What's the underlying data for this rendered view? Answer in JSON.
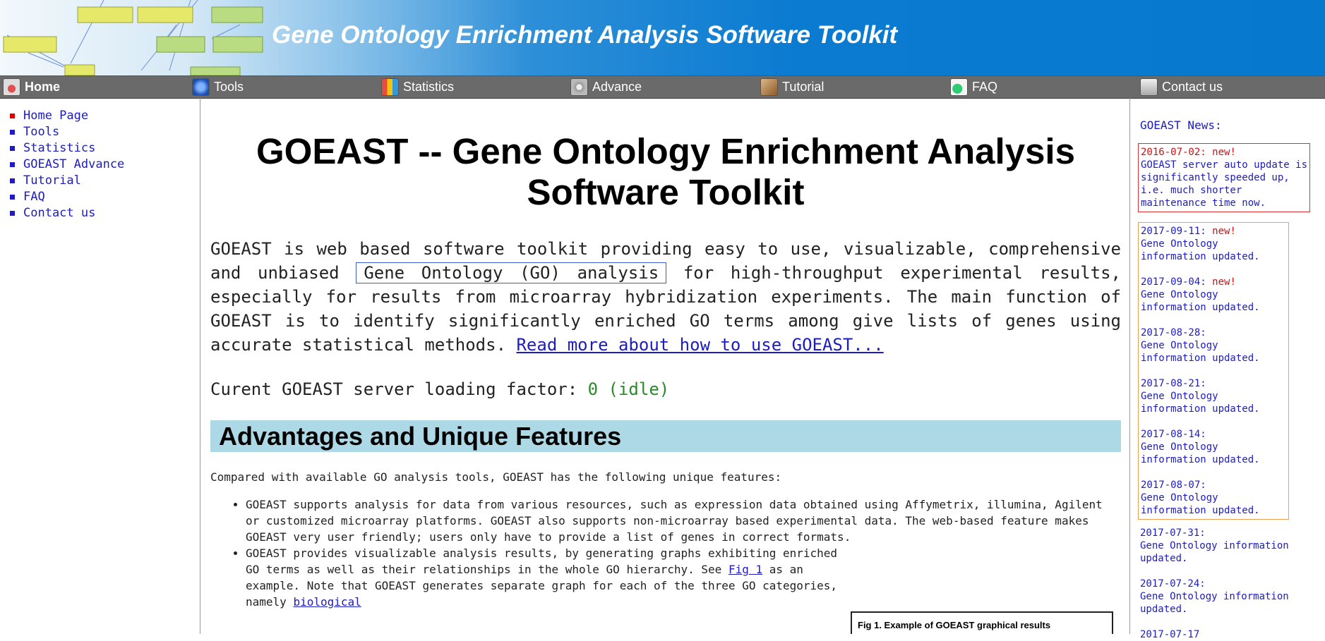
{
  "header": {
    "title": "Gene Ontology Enrichment Analysis Software Toolkit"
  },
  "nav": [
    {
      "label": "Home",
      "icon": "home-icon",
      "color": "#c0392b"
    },
    {
      "label": "Tools",
      "icon": "tools-icon",
      "color": "#2d6fcf"
    },
    {
      "label": "Statistics",
      "icon": "statistics-icon",
      "color": "#e67e22"
    },
    {
      "label": "Advance",
      "icon": "advance-icon",
      "color": "#8a8a8a"
    },
    {
      "label": "Tutorial",
      "icon": "tutorial-icon",
      "color": "#a0522d"
    },
    {
      "label": "FAQ",
      "icon": "faq-icon",
      "color": "#27ae60"
    },
    {
      "label": "Contact us",
      "icon": "contact-icon",
      "color": "#bbbbbb"
    }
  ],
  "sidebar": [
    {
      "label": "Home Page"
    },
    {
      "label": "Tools"
    },
    {
      "label": "Statistics"
    },
    {
      "label": "GOEAST Advance"
    },
    {
      "label": "Tutorial"
    },
    {
      "label": "FAQ"
    },
    {
      "label": "Contact us"
    }
  ],
  "main": {
    "title": "GOEAST -- Gene Ontology Enrichment Analysis Software Toolkit",
    "intro_1": "GOEAST is web based software toolkit providing easy to use, visualizable, comprehensive and unbiased ",
    "intro_boxed": "Gene Ontology (GO) analysis",
    "intro_2": " for high-throughput experimental results, especially for results from microarray hybridization experiments. The main function of GOEAST is to identify significantly enriched GO terms among give lists of genes using accurate statistical methods. ",
    "intro_link": "Read more about how to use GOEAST...",
    "load_label": "Curent GOEAST server loading factor: ",
    "load_value": "0 (idle)",
    "section_title": "Advantages and Unique Features",
    "compare_text": "Compared with available GO analysis tools, GOEAST has the following unique features:",
    "feature_1": "GOEAST supports analysis for data from various resources, such as expression data obtained using Affymetrix, illumina, Agilent or customized microarray platforms. GOEAST also supports non-microarray based experimental data. The web-based feature makes GOEAST very user friendly; users only have to provide a list of genes in correct formats.",
    "feature_2a": "GOEAST provides visualizable analysis results, by generating graphs exhibiting enriched GO terms as well as their relationships in the whole GO hierarchy. See ",
    "feature_2_link": "Fig 1",
    "feature_2b": " as an example. Note that GOEAST generates separate graph for each of the three GO categories, namely ",
    "feature_2_link2": "biological",
    "fig_caption": "Fig 1. Example of GOEAST graphical results"
  },
  "news": {
    "title": "GOEAST News:",
    "pinned": {
      "date": "2016-07-02:",
      "badge": "new!",
      "text": "GOEAST server auto update is significantly speeded up, i.e. much shorter maintenance time now."
    },
    "recent": [
      {
        "date": "2017-09-11:",
        "badge": "new!",
        "text": "Gene Ontology information updated."
      },
      {
        "date": "2017-09-04:",
        "badge": "new!",
        "text": "Gene Ontology information updated."
      },
      {
        "date": "2017-08-28:",
        "badge": "",
        "text": "Gene Ontology information updated."
      },
      {
        "date": "2017-08-21:",
        "badge": "",
        "text": "Gene Ontology information updated."
      },
      {
        "date": "2017-08-14:",
        "badge": "",
        "text": "Gene Ontology information updated."
      },
      {
        "date": "2017-08-07:",
        "badge": "",
        "text": "Gene Ontology information updated."
      }
    ],
    "older": [
      {
        "date": "2017-07-31:",
        "text": "Gene Ontology information updated."
      },
      {
        "date": "2017-07-24:",
        "text": "Gene Ontology information updated."
      },
      {
        "date": "2017-07-17",
        "text": ""
      }
    ]
  }
}
